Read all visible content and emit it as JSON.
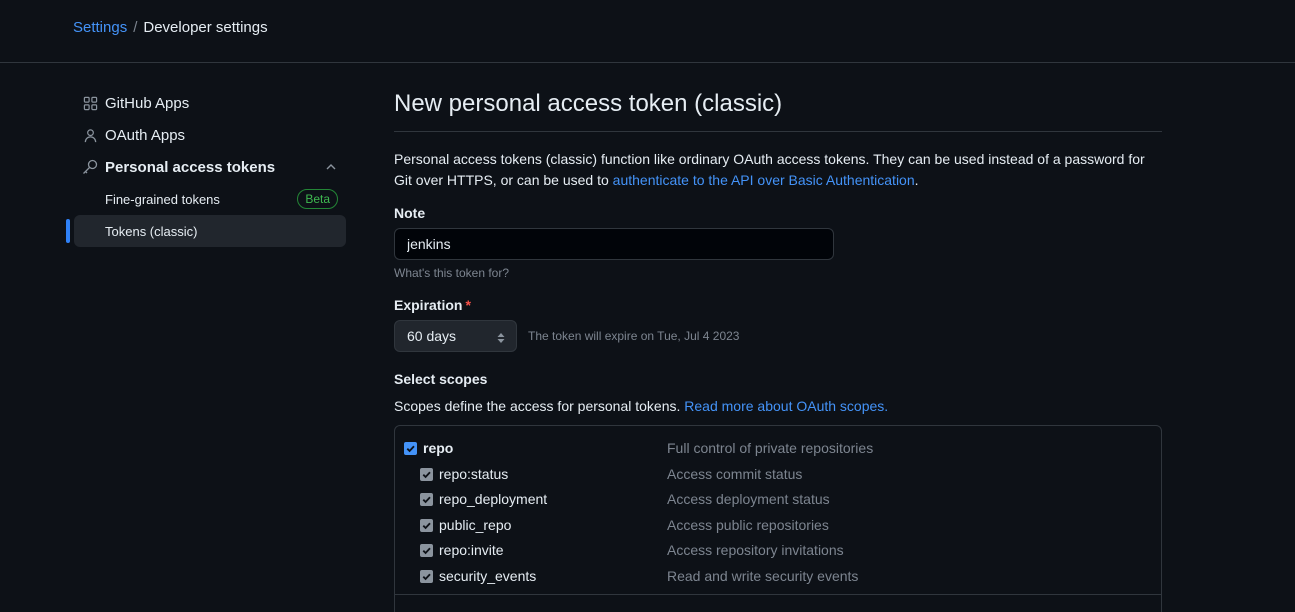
{
  "breadcrumb": {
    "settings": "Settings",
    "separator": "/",
    "current": "Developer settings"
  },
  "sidebar": {
    "items": [
      {
        "label": "GitHub Apps",
        "icon": "apps-icon"
      },
      {
        "label": "OAuth Apps",
        "icon": "person-icon"
      },
      {
        "label": "Personal access tokens",
        "icon": "key-icon"
      }
    ],
    "subitems": [
      {
        "label": "Fine-grained tokens",
        "badge": "Beta"
      },
      {
        "label": "Tokens (classic)"
      }
    ]
  },
  "main": {
    "title": "New personal access token (classic)",
    "description_prefix": "Personal access tokens (classic) function like ordinary OAuth access tokens. They can be used instead of a password for Git over HTTPS, or can be used to ",
    "description_link": "authenticate to the API over Basic Authentication",
    "description_suffix": ".",
    "note_label": "Note",
    "note_value": "jenkins",
    "note_hint": "What's this token for?",
    "expiration_label": "Expiration",
    "expiration_required": "*",
    "expiration_value": "60 days",
    "expiration_note": "The token will expire on Tue, Jul 4 2023",
    "scopes_label": "Select scopes",
    "scopes_desc": "Scopes define the access for personal tokens. ",
    "scopes_link": "Read more about OAuth scopes.",
    "scopes": [
      {
        "name": "repo",
        "desc": "Full control of private repositories",
        "checked": true
      },
      {
        "name": "repo:status",
        "desc": "Access commit status",
        "checked": true
      },
      {
        "name": "repo_deployment",
        "desc": "Access deployment status",
        "checked": true
      },
      {
        "name": "public_repo",
        "desc": "Access public repositories",
        "checked": true
      },
      {
        "name": "repo:invite",
        "desc": "Access repository invitations",
        "checked": true
      },
      {
        "name": "security_events",
        "desc": "Read and write security events",
        "checked": true
      }
    ]
  },
  "colors": {
    "background": "#0d1117",
    "accent": "#2f81f7",
    "link": "#4493f8",
    "badge": "#3fb950",
    "required": "#f85149"
  }
}
